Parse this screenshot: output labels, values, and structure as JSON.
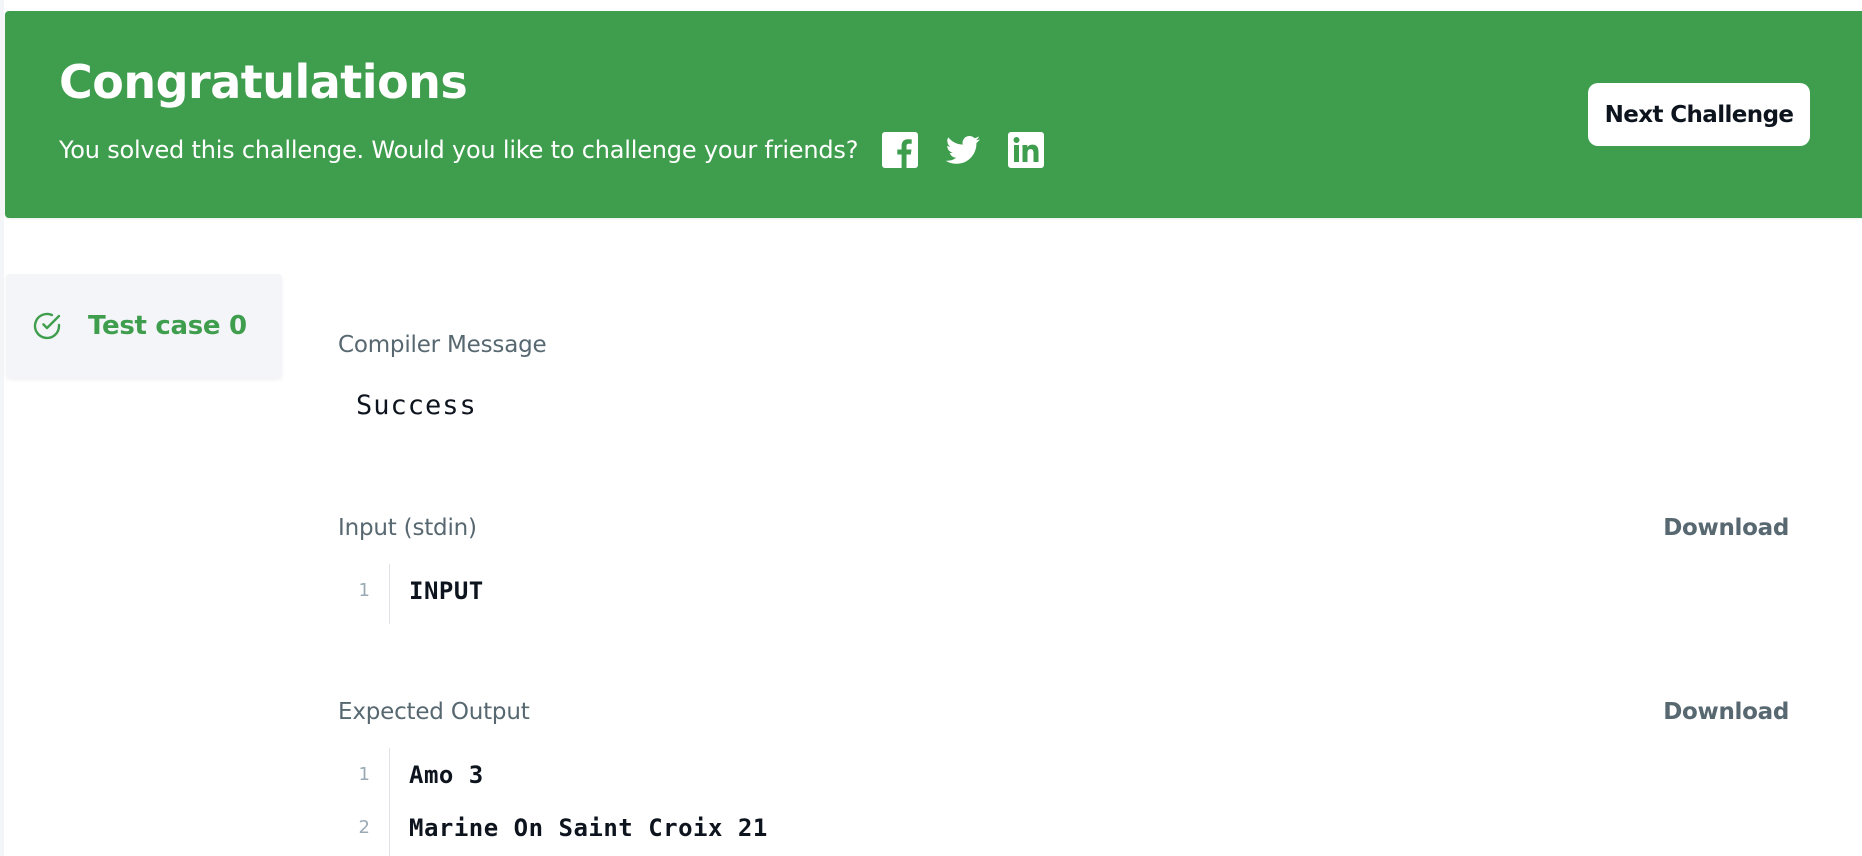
{
  "banner": {
    "title": "Congratulations",
    "message": "You solved this challenge. Would you like to challenge your friends?",
    "social_icons": [
      "facebook-icon",
      "twitter-icon",
      "linkedin-icon"
    ],
    "next_button_label": "Next Challenge",
    "background_color": "#3f9e4d"
  },
  "test_cases": [
    {
      "label": "Test case 0",
      "status": "passed",
      "status_icon": "check-circle-icon",
      "color": "#3f9e4d"
    }
  ],
  "compiler": {
    "label": "Compiler Message",
    "message": "Success"
  },
  "input": {
    "label": "Input (stdin)",
    "download_label": "Download",
    "lines": [
      {
        "num": "1",
        "text": "INPUT"
      }
    ]
  },
  "expected_output": {
    "label": "Expected Output",
    "download_label": "Download",
    "lines": [
      {
        "num": "1",
        "text": "Amo 3"
      },
      {
        "num": "2",
        "text": "Marine On Saint Croix 21"
      }
    ]
  }
}
